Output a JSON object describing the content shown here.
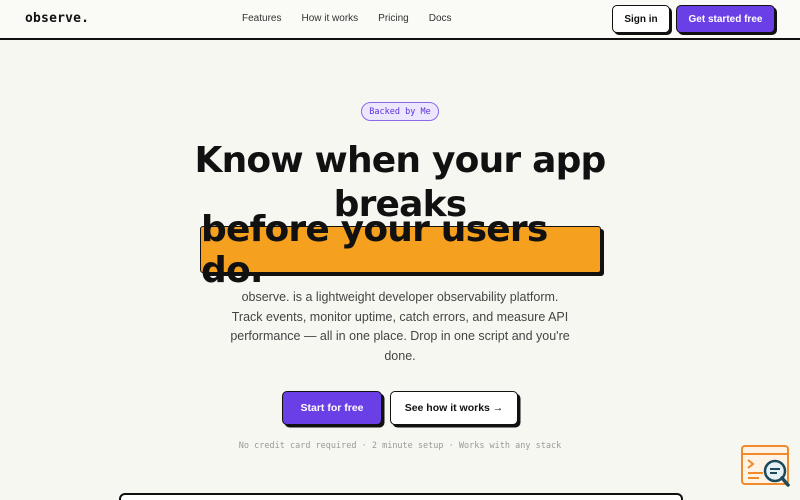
{
  "nav": {
    "logo": "observe.",
    "links": [
      "Features",
      "How it works",
      "Pricing",
      "Docs"
    ],
    "sign_in": "Sign in",
    "get_started": "Get started free"
  },
  "hero": {
    "badge": "Backed by Me",
    "title_line1": "Know when your app",
    "title_line2": "breaks",
    "highlight": "before your users do.",
    "description": "observe. is a lightweight developer observability platform. Track events, monitor uptime, catch errors, and measure API performance — all in one place. Drop in one script and you're done.",
    "cta_primary": "Start for free",
    "cta_secondary": "See how it works →",
    "subtext": "No credit card required · 2 minute setup · Works with any stack"
  },
  "colors": {
    "accent": "#6b3fe6",
    "highlight": "#f5a01f",
    "background": "#f7f7f2"
  },
  "icons": {
    "floating": "search-code-icon"
  }
}
